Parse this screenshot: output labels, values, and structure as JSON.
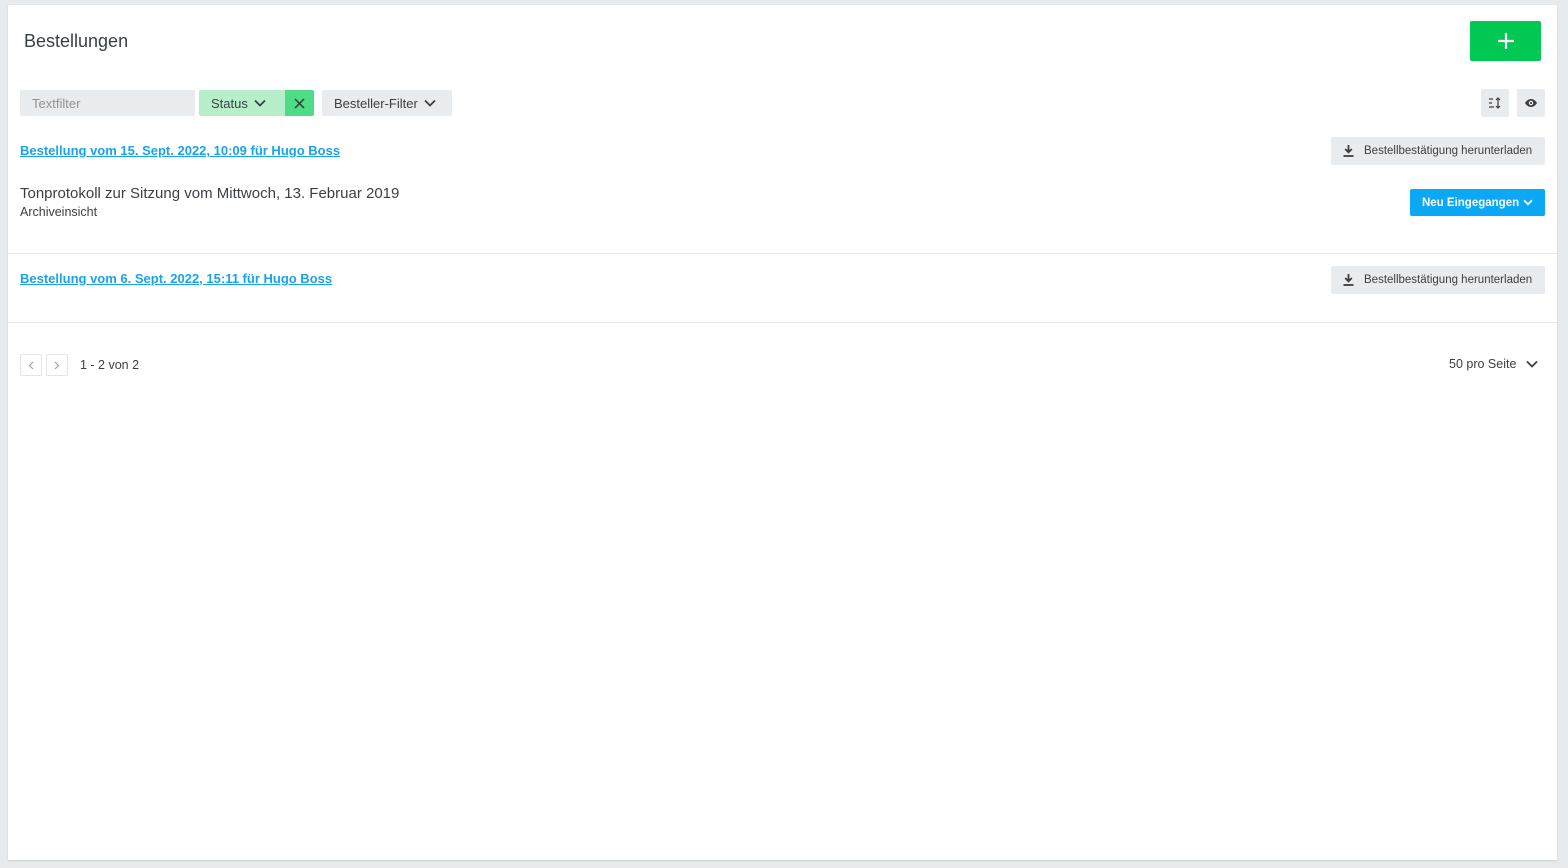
{
  "header": {
    "title": "Bestellungen",
    "add_icon": "plus-icon"
  },
  "filters": {
    "text_placeholder": "Textfilter",
    "text_value": "",
    "status_label": "Status",
    "besteller_label": "Besteller-Filter"
  },
  "toolbar": {
    "sort_icon": "sort-icon",
    "view_icon": "eye-icon"
  },
  "orders": [
    {
      "link": "Bestellung vom 15. Sept. 2022, 10:09 für Hugo Boss",
      "download_label": "Bestellbestätigung herunterladen",
      "items": [
        {
          "title": "Tonprotokoll zur Sitzung vom Mittwoch, 13. Februar 2019",
          "subtitle": "Archiveinsicht",
          "status": "Neu Eingegangen"
        }
      ]
    },
    {
      "link": "Bestellung vom 6. Sept. 2022, 15:11 für Hugo Boss",
      "download_label": "Bestellbestätigung herunterladen",
      "items": []
    }
  ],
  "pagination": {
    "range": "1 - 2 von 2",
    "per_page": "50 pro Seite"
  },
  "colors": {
    "primary_green": "#00c853",
    "status_filter_bg": "#b7efcb",
    "status_clear_bg": "#4fdc86",
    "link_blue": "#1aa3e8",
    "status_blue": "#0aa8f5"
  }
}
